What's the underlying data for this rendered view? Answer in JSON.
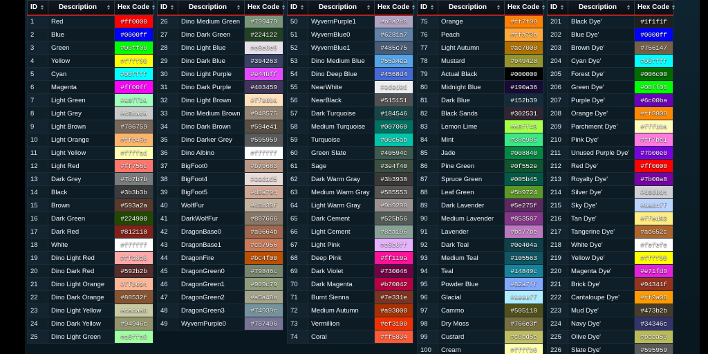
{
  "page": {
    "background": "#0d2028",
    "header_accent": "#b0231f",
    "sort_icon": "sort-updown-icon"
  },
  "columns": [
    {
      "header": {
        "id": "ID",
        "description": "Description",
        "hex": "Hex Code"
      },
      "rows": [
        {
          "id": "1",
          "desc": "Red",
          "hex": "#ff0000",
          "fg": "#ffffff"
        },
        {
          "id": "2",
          "desc": "Blue",
          "hex": "#0000ff",
          "fg": "#ffffff"
        },
        {
          "id": "3",
          "desc": "Green",
          "hex": "#00ff00",
          "fg": "#ffffff"
        },
        {
          "id": "4",
          "desc": "Yellow",
          "hex": "#ffff00",
          "fg": "#ffffff"
        },
        {
          "id": "5",
          "desc": "Cyan",
          "hex": "#00ffff",
          "fg": "#ffffff"
        },
        {
          "id": "6",
          "desc": "Magenta",
          "hex": "#ff00ff",
          "fg": "#ffffff"
        },
        {
          "id": "7",
          "desc": "Light Green",
          "hex": "#a0ffba",
          "fg": "#ffffff"
        },
        {
          "id": "8",
          "desc": "Light Grey",
          "hex": "#c8caca",
          "fg": "#ffffff"
        },
        {
          "id": "9",
          "desc": "Light Brown",
          "hex": "#786759",
          "fg": "#ffffff"
        },
        {
          "id": "10",
          "desc": "Light Orange",
          "hex": "#ffb46c",
          "fg": "#ffffff"
        },
        {
          "id": "11",
          "desc": "Light Yellow",
          "hex": "#ffffad",
          "fg": "#ffffff"
        },
        {
          "id": "12",
          "desc": "Light Red",
          "hex": "#ff756c",
          "fg": "#ffffff"
        },
        {
          "id": "13",
          "desc": "Dark Grey",
          "hex": "#7b7b7b",
          "fg": "#ffffff"
        },
        {
          "id": "14",
          "desc": "Black",
          "hex": "#3b3b3b",
          "fg": "#ffffff"
        },
        {
          "id": "15",
          "desc": "Brown",
          "hex": "#593a2a",
          "fg": "#ffffff"
        },
        {
          "id": "16",
          "desc": "Dark Green",
          "hex": "#224900",
          "fg": "#ffffff"
        },
        {
          "id": "17",
          "desc": "Dark Red",
          "hex": "#812118",
          "fg": "#ffffff"
        },
        {
          "id": "18",
          "desc": "White",
          "hex": "#ffffff",
          "fg": "#ffffff"
        },
        {
          "id": "19",
          "desc": "Dino Light Red",
          "hex": "#ffa8a8",
          "fg": "#ffffff"
        },
        {
          "id": "20",
          "desc": "Dino Dark Red",
          "hex": "#592b2b",
          "fg": "#ffffff"
        },
        {
          "id": "21",
          "desc": "Dino Light Orange",
          "hex": "#ffb694",
          "fg": "#ffffff"
        },
        {
          "id": "22",
          "desc": "Dino Dark Orange",
          "hex": "#88532f",
          "fg": "#ffffff"
        },
        {
          "id": "23",
          "desc": "Dino Light Yellow",
          "hex": "#cacaa0",
          "fg": "#ffffff"
        },
        {
          "id": "24",
          "desc": "Dino Dark Yellow",
          "hex": "#94946c",
          "fg": "#ffffff"
        },
        {
          "id": "25",
          "desc": "Dino Light Green",
          "hex": "#a0ffa0",
          "fg": "#ffffff"
        }
      ]
    },
    {
      "header": {
        "id": "ID",
        "description": "Description",
        "hex": "Hex Code"
      },
      "rows": [
        {
          "id": "26",
          "desc": "Dino Medium Green",
          "hex": "#799479",
          "fg": "#ffffff"
        },
        {
          "id": "27",
          "desc": "Dino Dark Green",
          "hex": "#224122",
          "fg": "#ffffff"
        },
        {
          "id": "28",
          "desc": "Dino Light Blue",
          "hex": "#e8e0e9",
          "fg": "#ffffff"
        },
        {
          "id": "29",
          "desc": "Dino Dark Blue",
          "hex": "#394263",
          "fg": "#ffffff"
        },
        {
          "id": "30",
          "desc": "Dino Light Purple",
          "hex": "#e44bff",
          "fg": "#ffffff"
        },
        {
          "id": "31",
          "desc": "Dino Dark Purple",
          "hex": "#403459",
          "fg": "#ffffff"
        },
        {
          "id": "32",
          "desc": "Dino Light Brown",
          "hex": "#ffe0ba",
          "fg": "#ffffff"
        },
        {
          "id": "33",
          "desc": "Dino Medium Brown",
          "hex": "#948575",
          "fg": "#ffffff"
        },
        {
          "id": "34",
          "desc": "Dino Dark Brown",
          "hex": "#594e41",
          "fg": "#ffffff"
        },
        {
          "id": "35",
          "desc": "Dino Darker Grey",
          "hex": "#595959",
          "fg": "#ffffff"
        },
        {
          "id": "36",
          "desc": "Dino Albino",
          "hex": "#ffffff",
          "fg": "#ffffff"
        },
        {
          "id": "37",
          "desc": "BigFoot0",
          "hex": "#b79683",
          "fg": "#ffffff"
        },
        {
          "id": "38",
          "desc": "BigFoot4",
          "hex": "#eadad5",
          "fg": "#ffffff"
        },
        {
          "id": "39",
          "desc": "BigFoot5",
          "hex": "#d0a794",
          "fg": "#ffffff"
        },
        {
          "id": "40",
          "desc": "WolfFur",
          "hex": "#c3b39f",
          "fg": "#ffffff"
        },
        {
          "id": "41",
          "desc": "DarkWolfFur",
          "hex": "#887666",
          "fg": "#ffffff"
        },
        {
          "id": "42",
          "desc": "DragonBase0",
          "hex": "#a0664b",
          "fg": "#ffffff"
        },
        {
          "id": "43",
          "desc": "DragonBase1",
          "hex": "#cb7956",
          "fg": "#ffffff"
        },
        {
          "id": "44",
          "desc": "DragonFire",
          "hex": "#bc4f00",
          "fg": "#ffffff"
        },
        {
          "id": "45",
          "desc": "DragonGreen0",
          "hex": "#79846c",
          "fg": "#ffffff"
        },
        {
          "id": "46",
          "desc": "DragonGreen1",
          "hex": "#909c79",
          "fg": "#ffffff"
        },
        {
          "id": "47",
          "desc": "DragonGreen2",
          "hex": "#a5a48b",
          "fg": "#ffffff"
        },
        {
          "id": "48",
          "desc": "DragonGreen3",
          "hex": "#74939c",
          "fg": "#ffffff"
        },
        {
          "id": "49",
          "desc": "WyvernPurple0",
          "hex": "#787496",
          "fg": "#ffffff"
        }
      ]
    },
    {
      "header": {
        "id": "ID",
        "description": "Description",
        "hex": "Hex Code"
      },
      "rows": [
        {
          "id": "50",
          "desc": "WyvernPurple1",
          "hex": "#b0a2c0",
          "fg": "#ffffff"
        },
        {
          "id": "51",
          "desc": "WyvernBlue0",
          "hex": "#6281a7",
          "fg": "#ffffff"
        },
        {
          "id": "52",
          "desc": "WyvernBlue1",
          "hex": "#485c75",
          "fg": "#ffffff"
        },
        {
          "id": "53",
          "desc": "Dino Medium Blue",
          "hex": "#55a4ea",
          "fg": "#ffffff"
        },
        {
          "id": "54",
          "desc": "Dino Deep Blue",
          "hex": "#4568d4",
          "fg": "#ffffff"
        },
        {
          "id": "55",
          "desc": "NearWhite",
          "hex": "#ededed",
          "fg": "#ffffff"
        },
        {
          "id": "56",
          "desc": "NearBlack",
          "hex": "#515151",
          "fg": "#ffffff"
        },
        {
          "id": "57",
          "desc": "Dark Turquoise",
          "hex": "#184546",
          "fg": "#ffffff"
        },
        {
          "id": "58",
          "desc": "Medium Turquoise",
          "hex": "#007060",
          "fg": "#ffffff"
        },
        {
          "id": "59",
          "desc": "Turquoise",
          "hex": "#00c5ab",
          "fg": "#ffffff"
        },
        {
          "id": "60",
          "desc": "Green Slate",
          "hex": "#40594c",
          "fg": "#ffffff"
        },
        {
          "id": "61",
          "desc": "Sage",
          "hex": "#3e4f40",
          "fg": "#ffffff"
        },
        {
          "id": "62",
          "desc": "Dark Warm Gray",
          "hex": "#3b3938",
          "fg": "#ffffff"
        },
        {
          "id": "63",
          "desc": "Medium Warm Gray",
          "hex": "#585553",
          "fg": "#ffffff"
        },
        {
          "id": "64",
          "desc": "Light Warm Gray",
          "hex": "#9b9290",
          "fg": "#ffffff"
        },
        {
          "id": "65",
          "desc": "Dark Cement",
          "hex": "#525b56",
          "fg": "#ffffff"
        },
        {
          "id": "66",
          "desc": "Light Cement",
          "hex": "#8aa196",
          "fg": "#ffffff"
        },
        {
          "id": "67",
          "desc": "Light Pink",
          "hex": "#e8b0ff",
          "fg": "#ffffff"
        },
        {
          "id": "68",
          "desc": "Deep Pink",
          "hex": "#ff119a",
          "fg": "#ffffff"
        },
        {
          "id": "69",
          "desc": "Dark Violet",
          "hex": "#730046",
          "fg": "#ffffff"
        },
        {
          "id": "70",
          "desc": "Dark Magenta",
          "hex": "#b70042",
          "fg": "#ffffff"
        },
        {
          "id": "71",
          "desc": "Burnt Sienna",
          "hex": "#7e331e",
          "fg": "#ffffff"
        },
        {
          "id": "72",
          "desc": "Medium Autumn",
          "hex": "#a93000",
          "fg": "#ffffff"
        },
        {
          "id": "73",
          "desc": "Vermillion",
          "hex": "#ef3100",
          "fg": "#ffffff"
        },
        {
          "id": "74",
          "desc": "Coral",
          "hex": "#ff5834",
          "fg": "#ffffff"
        }
      ]
    },
    {
      "header": {
        "id": "ID",
        "description": "Description",
        "hex": "Hex Code"
      },
      "rows": [
        {
          "id": "75",
          "desc": "Orange",
          "hex": "#ff7f00",
          "fg": "#ffffff"
        },
        {
          "id": "76",
          "desc": "Peach",
          "hex": "#ffa73b",
          "fg": "#ffffff"
        },
        {
          "id": "77",
          "desc": "Light Autumn",
          "hex": "#ae7000",
          "fg": "#ffffff"
        },
        {
          "id": "78",
          "desc": "Mustard",
          "hex": "#949428",
          "fg": "#ffffff"
        },
        {
          "id": "79",
          "desc": "Actual Black",
          "hex": "#000000",
          "fg": "#ffffff"
        },
        {
          "id": "80",
          "desc": "Midnight Blue",
          "hex": "#190a36",
          "fg": "#ffffff"
        },
        {
          "id": "81",
          "desc": "Dark Blue",
          "hex": "#152b39",
          "fg": "#ffffff"
        },
        {
          "id": "82",
          "desc": "Black Sands",
          "hex": "#302531",
          "fg": "#ffffff"
        },
        {
          "id": "83",
          "desc": "Lemon Lime",
          "hex": "#a8ff48",
          "fg": "#ffffff"
        },
        {
          "id": "84",
          "desc": "Mint",
          "hex": "#38e985",
          "fg": "#ffffff"
        },
        {
          "id": "85",
          "desc": "Jade",
          "hex": "#008840",
          "fg": "#ffffff"
        },
        {
          "id": "86",
          "desc": "Pine Green",
          "hex": "#0f552e",
          "fg": "#ffffff"
        },
        {
          "id": "87",
          "desc": "Spruce Green",
          "hex": "#005b45",
          "fg": "#ffffff"
        },
        {
          "id": "88",
          "desc": "Leaf Green",
          "hex": "#5b9724",
          "fg": "#ffffff"
        },
        {
          "id": "89",
          "desc": "Dark Lavender",
          "hex": "#5e275f",
          "fg": "#ffffff"
        },
        {
          "id": "90",
          "desc": "Medium Lavender",
          "hex": "#853587",
          "fg": "#ffffff"
        },
        {
          "id": "91",
          "desc": "Lavender",
          "hex": "#bd77be",
          "fg": "#ffffff"
        },
        {
          "id": "92",
          "desc": "Dark Teal",
          "hex": "#0e404a",
          "fg": "#ffffff"
        },
        {
          "id": "93",
          "desc": "Medium Teal",
          "hex": "#105563",
          "fg": "#ffffff"
        },
        {
          "id": "94",
          "desc": "Teal",
          "hex": "#14849c",
          "fg": "#ffffff"
        },
        {
          "id": "95",
          "desc": "Powder Blue",
          "hex": "#82a7ff",
          "fg": "#ffffff"
        },
        {
          "id": "96",
          "desc": "Glacial",
          "hex": "#aeeeff",
          "fg": "#ffffff"
        },
        {
          "id": "97",
          "desc": "Cammo",
          "hex": "#505118",
          "fg": "#ffffff"
        },
        {
          "id": "98",
          "desc": "Dry Moss",
          "hex": "#766e3f",
          "fg": "#ffffff"
        },
        {
          "id": "99",
          "desc": "Custard",
          "hex": "#c0bd5e",
          "fg": "#ffffff"
        },
        {
          "id": "100",
          "desc": "Cream",
          "hex": "#ffffb0",
          "fg": "#ffffff"
        }
      ]
    },
    {
      "header": {
        "id": "ID",
        "description": "Description",
        "hex": "Hex Code"
      },
      "rows": [
        {
          "id": "201",
          "desc": "Black Dye'",
          "hex": "#1f1f1f",
          "fg": "#ffffff"
        },
        {
          "id": "202",
          "desc": "Blue Dye'",
          "hex": "#0000ff",
          "fg": "#ffffff"
        },
        {
          "id": "203",
          "desc": "Brown Dye'",
          "hex": "#756147",
          "fg": "#ffffff"
        },
        {
          "id": "204",
          "desc": "Cyan Dye'",
          "hex": "#00ffff",
          "fg": "#ffffff"
        },
        {
          "id": "205",
          "desc": "Forest Dye'",
          "hex": "#006c00",
          "fg": "#ffffff"
        },
        {
          "id": "206",
          "desc": "Green Dye'",
          "hex": "#00ff00",
          "fg": "#ffffff"
        },
        {
          "id": "207",
          "desc": "Purple Dye'",
          "hex": "#6c00ba",
          "fg": "#ffffff"
        },
        {
          "id": "208",
          "desc": "Orange Dye'",
          "hex": "#ff8800",
          "fg": "#ffffff"
        },
        {
          "id": "209",
          "desc": "Parchment Dye'",
          "hex": "#fffbba",
          "fg": "#ffffff"
        },
        {
          "id": "210",
          "desc": "Pink Dye'",
          "hex": "#ff7be1",
          "fg": "#ffffff"
        },
        {
          "id": "211",
          "desc": "Unused Purple Dye'",
          "hex": "#7b00e0",
          "fg": "#ffffff"
        },
        {
          "id": "212",
          "desc": "Red Dye'",
          "hex": "#ff0000",
          "fg": "#ffffff"
        },
        {
          "id": "213",
          "desc": "Royalty Dye'",
          "hex": "#7b00a8",
          "fg": "#ffffff"
        },
        {
          "id": "214",
          "desc": "Silver Dye'",
          "hex": "#d0d0d4",
          "fg": "#ffffff"
        },
        {
          "id": "215",
          "desc": "Sky Dye'",
          "hex": "#bad4ff",
          "fg": "#ffffff"
        },
        {
          "id": "216",
          "desc": "Tan Dye'",
          "hex": "#ffed82",
          "fg": "#ffffff"
        },
        {
          "id": "217",
          "desc": "Tangerine Dye'",
          "hex": "#ad652c",
          "fg": "#ffffff"
        },
        {
          "id": "218",
          "desc": "White Dye'",
          "hex": "#fefefe",
          "fg": "#ffffff"
        },
        {
          "id": "219",
          "desc": "Yellow Dye'",
          "hex": "#ffff00",
          "fg": "#ffffff"
        },
        {
          "id": "220",
          "desc": "Magenta Dye'",
          "hex": "#e71fd9",
          "fg": "#ffffff"
        },
        {
          "id": "221",
          "desc": "Brick Dye'",
          "hex": "#94341f",
          "fg": "#ffffff"
        },
        {
          "id": "222",
          "desc": "Cantaloupe Dye'",
          "hex": "#ff9a00",
          "fg": "#ffffff"
        },
        {
          "id": "223",
          "desc": "Mud Dye'",
          "hex": "#473b2b",
          "fg": "#ffffff"
        },
        {
          "id": "224",
          "desc": "Navy Dye'",
          "hex": "#34346c",
          "fg": "#ffffff"
        },
        {
          "id": "225",
          "desc": "Olive Dye'",
          "hex": "#baba59",
          "fg": "#ffffff"
        },
        {
          "id": "226",
          "desc": "Slate Dye'",
          "hex": "#595959",
          "fg": "#ffffff"
        }
      ]
    }
  ]
}
